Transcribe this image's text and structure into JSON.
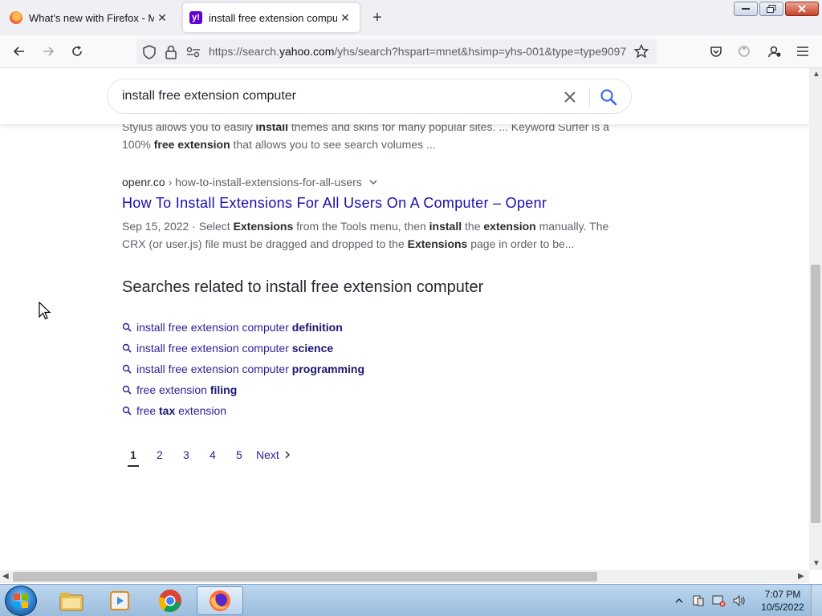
{
  "browser": {
    "tabs": [
      {
        "title": "What's new with Firefox - More",
        "favicon": "firefox-icon",
        "active": false
      },
      {
        "title": "install free extension computer",
        "favicon": "yahoo-icon",
        "active": true
      }
    ],
    "url": {
      "prefix": "https://search.",
      "host": "yahoo.com",
      "path": "/yhs/search?hspart=mnet&hsimp=yhs-001&type=type9097"
    }
  },
  "search": {
    "query": "install free extension computer"
  },
  "results": [
    {
      "snippet": "Stylus allows you to easily <b>install</b> themes and skins for many popular sites. ... Keyword Surfer is a 100% <b>free extension</b> that allows you to see search volumes ..."
    },
    {
      "site": "openr.co",
      "path": " › how-to-install-extensions-for-all-users",
      "title": "How To Install Extensions For All Users On A Computer – Openr",
      "date": "Sep 15, 2022 · ",
      "snippet": "Select <b>Extensions</b> from the Tools menu, then <b>install</b> the <b>extension</b> manually. The CRX (or user.js) file must be dragged and dropped to the <b>Extensions</b> page in order to be..."
    }
  ],
  "related": {
    "title": "Searches related to install free extension computer",
    "items": [
      {
        "base": "install free extension computer ",
        "bold": "definition",
        "after": ""
      },
      {
        "base": "install free extension computer ",
        "bold": "science",
        "after": ""
      },
      {
        "base": "install free extension computer ",
        "bold": "programming",
        "after": ""
      },
      {
        "base": "free extension ",
        "bold": "filing",
        "after": ""
      },
      {
        "base": "free ",
        "bold": "tax",
        "after": " extension"
      }
    ]
  },
  "pagination": {
    "pages": [
      "1",
      "2",
      "3",
      "4",
      "5"
    ],
    "current": "1",
    "next": "Next"
  },
  "taskbar": {
    "time": "7:07 PM",
    "date": "10/5/2022",
    "apps": [
      "file-explorer-icon",
      "media-player-icon",
      "chrome-icon",
      "firefox-icon"
    ]
  }
}
